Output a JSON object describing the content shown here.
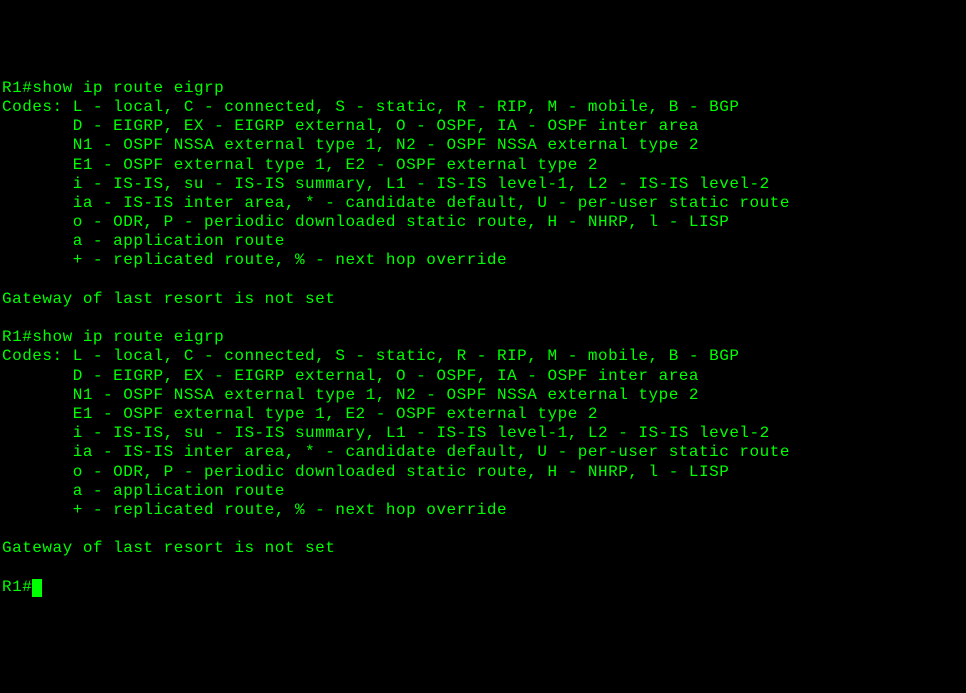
{
  "terminal": {
    "block1": {
      "prompt": "R1#",
      "command": "show ip route eigrp",
      "codes_header": "Codes: L - local, C - connected, S - static, R - RIP, M - mobile, B - BGP",
      "codes_line2": "       D - EIGRP, EX - EIGRP external, O - OSPF, IA - OSPF inter area",
      "codes_line3": "       N1 - OSPF NSSA external type 1, N2 - OSPF NSSA external type 2",
      "codes_line4": "       E1 - OSPF external type 1, E2 - OSPF external type 2",
      "codes_line5": "       i - IS-IS, su - IS-IS summary, L1 - IS-IS level-1, L2 - IS-IS level-2",
      "codes_line6": "       ia - IS-IS inter area, * - candidate default, U - per-user static route",
      "codes_line7": "       o - ODR, P - periodic downloaded static route, H - NHRP, l - LISP",
      "codes_line8": "       a - application route",
      "codes_line9": "       + - replicated route, % - next hop override",
      "gateway": "Gateway of last resort is not set"
    },
    "block2": {
      "prompt": "R1#",
      "command": "show ip route eigrp",
      "codes_header": "Codes: L - local, C - connected, S - static, R - RIP, M - mobile, B - BGP",
      "codes_line2": "       D - EIGRP, EX - EIGRP external, O - OSPF, IA - OSPF inter area",
      "codes_line3": "       N1 - OSPF NSSA external type 1, N2 - OSPF NSSA external type 2",
      "codes_line4": "       E1 - OSPF external type 1, E2 - OSPF external type 2",
      "codes_line5": "       i - IS-IS, su - IS-IS summary, L1 - IS-IS level-1, L2 - IS-IS level-2",
      "codes_line6": "       ia - IS-IS inter area, * - candidate default, U - per-user static route",
      "codes_line7": "       o - ODR, P - periodic downloaded static route, H - NHRP, l - LISP",
      "codes_line8": "       a - application route",
      "codes_line9": "       + - replicated route, % - next hop override",
      "gateway": "Gateway of last resort is not set"
    },
    "final_prompt": "R1#"
  }
}
